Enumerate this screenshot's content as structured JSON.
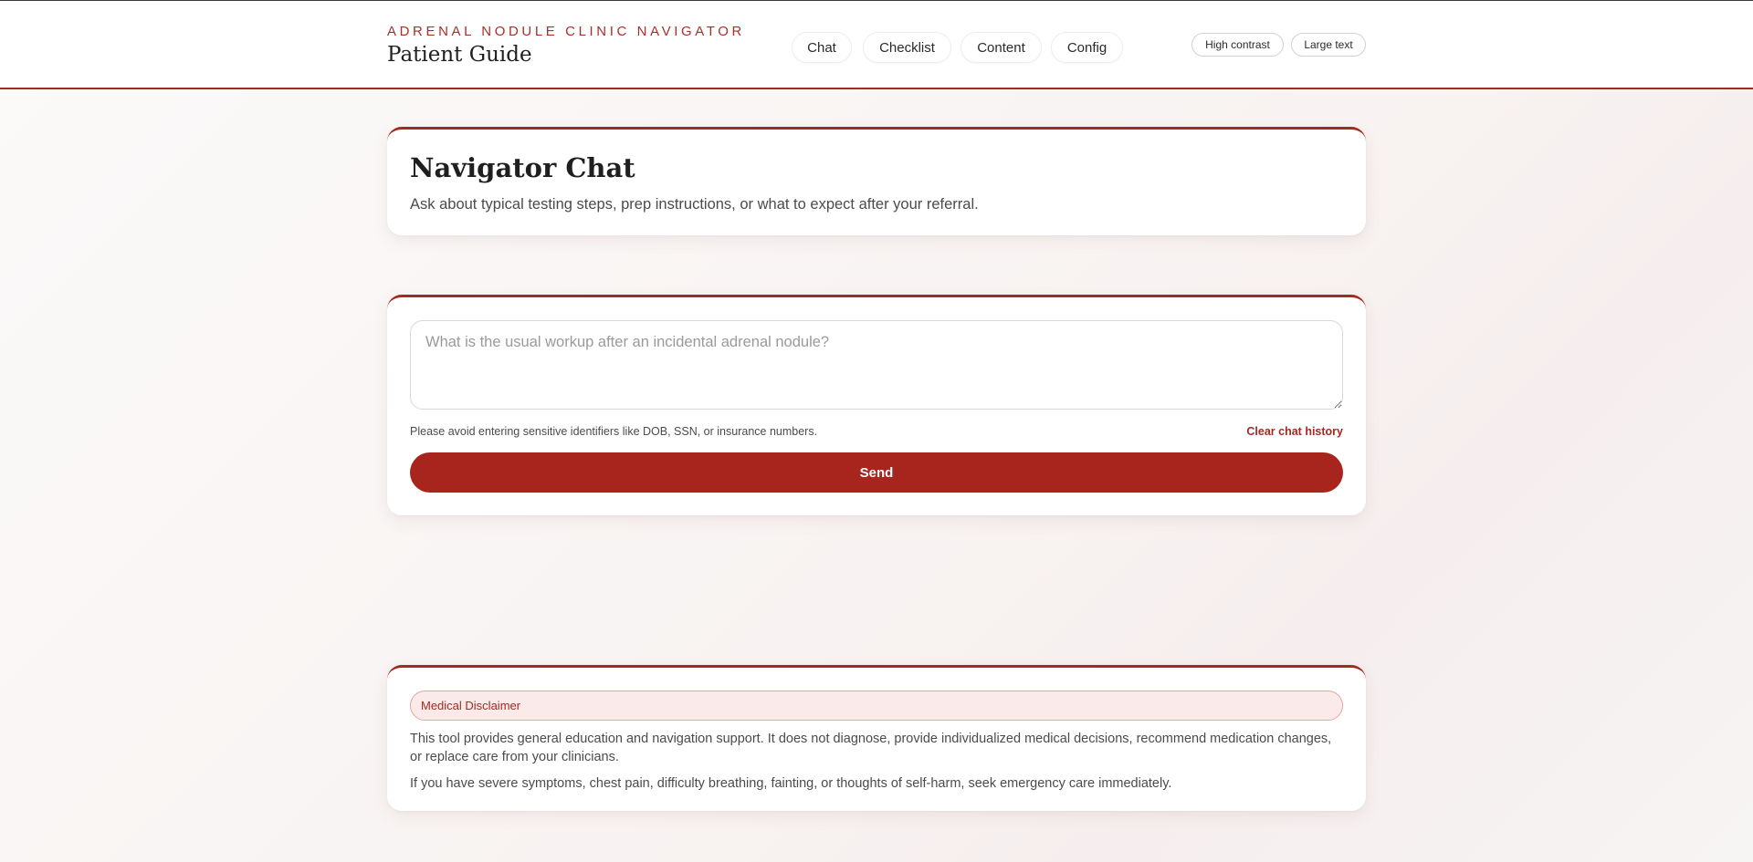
{
  "brand": {
    "kicker": "ADRENAL NODULE CLINIC NAVIGATOR",
    "title": "Patient Guide"
  },
  "nav": {
    "items": [
      {
        "label": "Chat"
      },
      {
        "label": "Checklist"
      },
      {
        "label": "Content"
      },
      {
        "label": "Config"
      }
    ]
  },
  "accessibility": {
    "high_contrast": "High contrast",
    "large_text": "Large text"
  },
  "page": {
    "title": "Navigator Chat",
    "subtitle": "Ask about typical testing steps, prep instructions, or what to expect after your referral."
  },
  "chat": {
    "input_value": "",
    "input_placeholder": "What is the usual workup after an incidental adrenal nodule?",
    "privacy_note": "Please avoid entering sensitive identifiers like DOB, SSN, or insurance numbers.",
    "clear_label": "Clear chat history",
    "send_label": "Send"
  },
  "disclaimer": {
    "badge": "Medical Disclaimer",
    "paragraph1": "This tool provides general education and navigation support. It does not diagnose, provide individualized medical decisions, recommend medication changes, or replace care from your clinicians.",
    "paragraph2": "If you have severe symptoms, chest pain, difficulty breathing, fainting, or thoughts of self-harm, seek emergency care immediately."
  },
  "colors": {
    "accent": "#a32a22",
    "send_button": "#a8251e",
    "badge_background": "#fbeaea"
  }
}
